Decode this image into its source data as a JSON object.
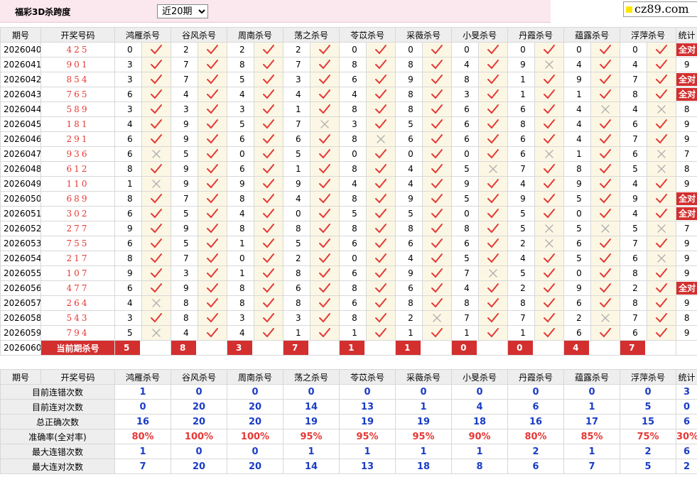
{
  "header": {
    "title": "福彩3D杀跨度",
    "period_select": {
      "selected": "近20期",
      "options": [
        "近20期"
      ]
    },
    "logo_text": "cz89.com"
  },
  "columns": [
    "期号",
    "开奖号码",
    "鸿雁杀号",
    "谷风杀号",
    "周南杀号",
    "荡之杀号",
    "苓苡杀号",
    "采薇杀号",
    "小旻杀号",
    "丹霞杀号",
    "蕴露杀号",
    "浮萍杀号",
    "统计"
  ],
  "experts": [
    "鸿雁杀号",
    "谷风杀号",
    "周南杀号",
    "荡之杀号",
    "苓苡杀号",
    "采薇杀号",
    "小旻杀号",
    "丹霞杀号",
    "蕴露杀号",
    "浮萍杀号"
  ],
  "rows": [
    {
      "period": "2026040",
      "numbers": "425",
      "picks": [
        [
          "0",
          true
        ],
        [
          "2",
          true
        ],
        [
          "2",
          true
        ],
        [
          "2",
          true
        ],
        [
          "0",
          true
        ],
        [
          "0",
          true
        ],
        [
          "0",
          true
        ],
        [
          "0",
          true
        ],
        [
          "0",
          true
        ],
        [
          "0",
          true
        ]
      ],
      "stat": "全对"
    },
    {
      "period": "2026041",
      "numbers": "901",
      "picks": [
        [
          "3",
          true
        ],
        [
          "7",
          true
        ],
        [
          "8",
          true
        ],
        [
          "7",
          true
        ],
        [
          "8",
          true
        ],
        [
          "8",
          true
        ],
        [
          "4",
          true
        ],
        [
          "9",
          false
        ],
        [
          "4",
          true
        ],
        [
          "4",
          true
        ]
      ],
      "stat": "9"
    },
    {
      "period": "2026042",
      "numbers": "854",
      "picks": [
        [
          "3",
          true
        ],
        [
          "7",
          true
        ],
        [
          "5",
          true
        ],
        [
          "3",
          true
        ],
        [
          "6",
          true
        ],
        [
          "9",
          true
        ],
        [
          "8",
          true
        ],
        [
          "1",
          true
        ],
        [
          "9",
          true
        ],
        [
          "7",
          true
        ]
      ],
      "stat": "全对"
    },
    {
      "period": "2026043",
      "numbers": "765",
      "picks": [
        [
          "6",
          true
        ],
        [
          "4",
          true
        ],
        [
          "4",
          true
        ],
        [
          "4",
          true
        ],
        [
          "4",
          true
        ],
        [
          "8",
          true
        ],
        [
          "3",
          true
        ],
        [
          "1",
          true
        ],
        [
          "1",
          true
        ],
        [
          "8",
          true
        ]
      ],
      "stat": "全对"
    },
    {
      "period": "2026044",
      "numbers": "589",
      "picks": [
        [
          "3",
          true
        ],
        [
          "3",
          true
        ],
        [
          "3",
          true
        ],
        [
          "1",
          true
        ],
        [
          "8",
          true
        ],
        [
          "8",
          true
        ],
        [
          "6",
          true
        ],
        [
          "6",
          true
        ],
        [
          "4",
          false
        ],
        [
          "4",
          false
        ]
      ],
      "stat": "8"
    },
    {
      "period": "2026045",
      "numbers": "181",
      "picks": [
        [
          "4",
          true
        ],
        [
          "9",
          true
        ],
        [
          "5",
          true
        ],
        [
          "7",
          false
        ],
        [
          "3",
          true
        ],
        [
          "5",
          true
        ],
        [
          "6",
          true
        ],
        [
          "8",
          true
        ],
        [
          "4",
          true
        ],
        [
          "6",
          true
        ]
      ],
      "stat": "9"
    },
    {
      "period": "2026046",
      "numbers": "291",
      "picks": [
        [
          "6",
          true
        ],
        [
          "9",
          true
        ],
        [
          "6",
          true
        ],
        [
          "6",
          true
        ],
        [
          "8",
          false
        ],
        [
          "6",
          true
        ],
        [
          "6",
          true
        ],
        [
          "6",
          true
        ],
        [
          "4",
          true
        ],
        [
          "7",
          true
        ]
      ],
      "stat": "9"
    },
    {
      "period": "2026047",
      "numbers": "936",
      "picks": [
        [
          "6",
          false
        ],
        [
          "5",
          true
        ],
        [
          "0",
          true
        ],
        [
          "5",
          true
        ],
        [
          "0",
          true
        ],
        [
          "0",
          true
        ],
        [
          "0",
          true
        ],
        [
          "6",
          false
        ],
        [
          "1",
          true
        ],
        [
          "6",
          false
        ]
      ],
      "stat": "7"
    },
    {
      "period": "2026048",
      "numbers": "612",
      "picks": [
        [
          "8",
          true
        ],
        [
          "9",
          true
        ],
        [
          "6",
          true
        ],
        [
          "1",
          true
        ],
        [
          "8",
          true
        ],
        [
          "4",
          true
        ],
        [
          "5",
          false
        ],
        [
          "7",
          true
        ],
        [
          "8",
          true
        ],
        [
          "5",
          false
        ]
      ],
      "stat": "8"
    },
    {
      "period": "2026049",
      "numbers": "110",
      "picks": [
        [
          "1",
          false
        ],
        [
          "9",
          true
        ],
        [
          "9",
          true
        ],
        [
          "9",
          true
        ],
        [
          "4",
          true
        ],
        [
          "4",
          true
        ],
        [
          "9",
          true
        ],
        [
          "4",
          true
        ],
        [
          "9",
          true
        ],
        [
          "4",
          true
        ]
      ],
      "stat": "9"
    },
    {
      "period": "2026050",
      "numbers": "689",
      "picks": [
        [
          "8",
          true
        ],
        [
          "7",
          true
        ],
        [
          "8",
          true
        ],
        [
          "4",
          true
        ],
        [
          "8",
          true
        ],
        [
          "9",
          true
        ],
        [
          "5",
          true
        ],
        [
          "9",
          true
        ],
        [
          "5",
          true
        ],
        [
          "9",
          true
        ]
      ],
      "stat": "全对"
    },
    {
      "period": "2026051",
      "numbers": "302",
      "picks": [
        [
          "6",
          true
        ],
        [
          "5",
          true
        ],
        [
          "4",
          true
        ],
        [
          "0",
          true
        ],
        [
          "5",
          true
        ],
        [
          "5",
          true
        ],
        [
          "0",
          true
        ],
        [
          "5",
          true
        ],
        [
          "0",
          true
        ],
        [
          "4",
          true
        ]
      ],
      "stat": "全对"
    },
    {
      "period": "2026052",
      "numbers": "277",
      "picks": [
        [
          "9",
          true
        ],
        [
          "9",
          true
        ],
        [
          "8",
          true
        ],
        [
          "8",
          true
        ],
        [
          "8",
          true
        ],
        [
          "8",
          true
        ],
        [
          "8",
          true
        ],
        [
          "5",
          false
        ],
        [
          "5",
          false
        ],
        [
          "5",
          false
        ]
      ],
      "stat": "7"
    },
    {
      "period": "2026053",
      "numbers": "755",
      "picks": [
        [
          "6",
          true
        ],
        [
          "5",
          true
        ],
        [
          "1",
          true
        ],
        [
          "5",
          true
        ],
        [
          "6",
          true
        ],
        [
          "6",
          true
        ],
        [
          "6",
          true
        ],
        [
          "2",
          false
        ],
        [
          "6",
          true
        ],
        [
          "7",
          true
        ]
      ],
      "stat": "9"
    },
    {
      "period": "2026054",
      "numbers": "217",
      "picks": [
        [
          "8",
          true
        ],
        [
          "7",
          true
        ],
        [
          "0",
          true
        ],
        [
          "2",
          true
        ],
        [
          "0",
          true
        ],
        [
          "4",
          true
        ],
        [
          "5",
          true
        ],
        [
          "4",
          true
        ],
        [
          "5",
          true
        ],
        [
          "6",
          false
        ]
      ],
      "stat": "9"
    },
    {
      "period": "2026055",
      "numbers": "107",
      "picks": [
        [
          "9",
          true
        ],
        [
          "3",
          true
        ],
        [
          "1",
          true
        ],
        [
          "8",
          true
        ],
        [
          "6",
          true
        ],
        [
          "9",
          true
        ],
        [
          "7",
          false
        ],
        [
          "5",
          true
        ],
        [
          "0",
          true
        ],
        [
          "8",
          true
        ]
      ],
      "stat": "9"
    },
    {
      "period": "2026056",
      "numbers": "477",
      "picks": [
        [
          "6",
          true
        ],
        [
          "9",
          true
        ],
        [
          "8",
          true
        ],
        [
          "6",
          true
        ],
        [
          "8",
          true
        ],
        [
          "6",
          true
        ],
        [
          "4",
          true
        ],
        [
          "2",
          true
        ],
        [
          "9",
          true
        ],
        [
          "2",
          true
        ]
      ],
      "stat": "全对"
    },
    {
      "period": "2026057",
      "numbers": "264",
      "picks": [
        [
          "4",
          false
        ],
        [
          "8",
          true
        ],
        [
          "8",
          true
        ],
        [
          "8",
          true
        ],
        [
          "6",
          true
        ],
        [
          "8",
          true
        ],
        [
          "8",
          true
        ],
        [
          "8",
          true
        ],
        [
          "6",
          true
        ],
        [
          "8",
          true
        ]
      ],
      "stat": "9"
    },
    {
      "period": "2026058",
      "numbers": "543",
      "picks": [
        [
          "3",
          true
        ],
        [
          "8",
          true
        ],
        [
          "3",
          true
        ],
        [
          "3",
          true
        ],
        [
          "8",
          true
        ],
        [
          "2",
          false
        ],
        [
          "7",
          true
        ],
        [
          "7",
          true
        ],
        [
          "2",
          false
        ],
        [
          "7",
          true
        ]
      ],
      "stat": "8"
    },
    {
      "period": "2026059",
      "numbers": "794",
      "picks": [
        [
          "5",
          false
        ],
        [
          "4",
          true
        ],
        [
          "4",
          true
        ],
        [
          "1",
          true
        ],
        [
          "1",
          true
        ],
        [
          "1",
          true
        ],
        [
          "1",
          true
        ],
        [
          "1",
          true
        ],
        [
          "6",
          true
        ],
        [
          "6",
          true
        ]
      ],
      "stat": "9"
    }
  ],
  "current": {
    "period": "2026060",
    "label": "当前期杀号",
    "picks": [
      "5",
      "8",
      "3",
      "7",
      "1",
      "1",
      "0",
      "0",
      "4",
      "7"
    ]
  },
  "summary": {
    "header": [
      "期号",
      "开奖号码",
      "鸿雁杀号",
      "谷风杀号",
      "周南杀号",
      "荡之杀号",
      "苓苡杀号",
      "采薇杀号",
      "小旻杀号",
      "丹霞杀号",
      "蕴露杀号",
      "浮萍杀号",
      "统计"
    ],
    "rows": [
      {
        "label": "目前连错次数",
        "values": [
          "1",
          "0",
          "0",
          "0",
          "0",
          "0",
          "0",
          "0",
          "0",
          "0",
          "3"
        ],
        "red": false
      },
      {
        "label": "目前连对次数",
        "values": [
          "0",
          "20",
          "20",
          "14",
          "13",
          "1",
          "4",
          "6",
          "1",
          "5",
          "0"
        ],
        "red": false
      },
      {
        "label": "总正确次数",
        "values": [
          "16",
          "20",
          "20",
          "19",
          "19",
          "19",
          "18",
          "16",
          "17",
          "15",
          "6"
        ],
        "red": false
      },
      {
        "label": "准确率(全对率)",
        "values": [
          "80%",
          "100%",
          "100%",
          "95%",
          "95%",
          "95%",
          "90%",
          "80%",
          "85%",
          "75%",
          "30%"
        ],
        "red": true
      },
      {
        "label": "最大连错次数",
        "values": [
          "1",
          "0",
          "0",
          "1",
          "1",
          "1",
          "1",
          "2",
          "1",
          "2",
          "6"
        ],
        "red": false
      },
      {
        "label": "最大连对次数",
        "values": [
          "7",
          "20",
          "20",
          "14",
          "13",
          "18",
          "8",
          "6",
          "7",
          "5",
          "2"
        ],
        "red": false
      }
    ]
  },
  "colors": {
    "hit": "#e53935",
    "miss": "#b0b0b0",
    "accent": "#d32f2f",
    "value": "#1a3cc8",
    "mark_bg": "#fbf7e4",
    "header_bg": "#eeeeee",
    "topbar_bg": "#fbe7ee"
  },
  "icons": {
    "hit": "check-icon",
    "miss": "cross-icon"
  }
}
